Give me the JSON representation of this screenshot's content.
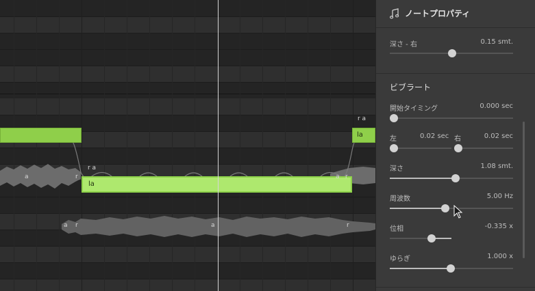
{
  "panel": {
    "title": "ノートプロパティ",
    "title_icon": "music-note-icon",
    "depth_right": {
      "label": "深さ - 右",
      "value": "0.15 smt.",
      "level": 0.5
    },
    "vibrato": {
      "title": "ビブラート",
      "start_timing": {
        "label": "開始タイミング",
        "value": "0.000 sec",
        "level": 0.0
      },
      "left": {
        "label": "左",
        "value": "0.02 sec",
        "level": 0.0
      },
      "right": {
        "label": "右",
        "value": "0.02 sec",
        "level": 0.0
      },
      "depth": {
        "label": "深さ",
        "value": "1.08 smt.",
        "level": 0.52
      },
      "frequency": {
        "label": "周波数",
        "value": "5.00 Hz",
        "level": 0.47
      },
      "phase": {
        "label": "位相",
        "value": "-0.335 x",
        "level": 0.32
      },
      "jitter": {
        "label": "ゆらぎ",
        "value": "1.000 x",
        "level": 0.5
      }
    }
  },
  "roll": {
    "notes": [
      {
        "lyric": ""
      },
      {
        "lyric": "la",
        "selected": true
      },
      {
        "lyric": "la"
      }
    ],
    "phonemes": [
      "r a",
      "r a",
      "a",
      "r",
      "a",
      "r",
      "a",
      "r",
      "a",
      "r"
    ]
  },
  "colors": {
    "note": "#8fcf4a",
    "note_selected": "#aee86e",
    "panel_bg": "#3a3a3a",
    "roll_bg": "#2b2b2b"
  }
}
